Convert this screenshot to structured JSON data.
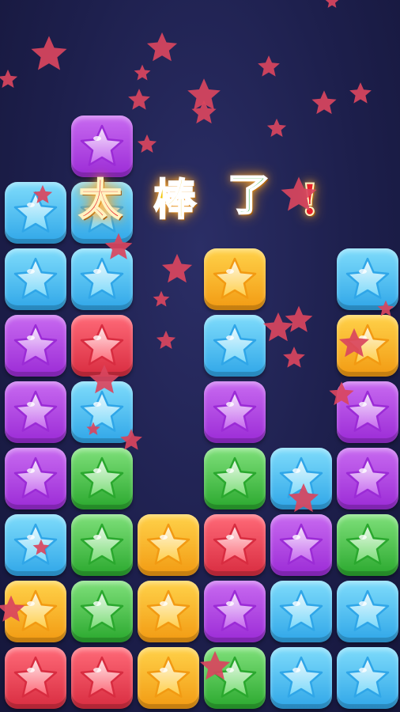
{
  "colors": {
    "purple": [
      "#c86af0",
      "#9b2bd6"
    ],
    "blue": [
      "#7fdcfb",
      "#2fa6e8"
    ],
    "red": [
      "#ff6a78",
      "#d82c40"
    ],
    "green": [
      "#7fe07a",
      "#2aa82e"
    ],
    "yellow": [
      "#ffd24a",
      "#f29a12"
    ],
    "particle": "#d9455e"
  },
  "board": {
    "columns": 6,
    "rows": [
      [
        null,
        "purple",
        null,
        null,
        null,
        null
      ],
      [
        "blue",
        "blue",
        null,
        null,
        null,
        null
      ],
      [
        "blue",
        "blue",
        null,
        "yellow",
        null,
        "blue"
      ],
      [
        "purple",
        "red",
        null,
        "blue",
        null,
        "yellow"
      ],
      [
        "purple",
        "blue",
        null,
        "purple",
        null,
        "purple"
      ],
      [
        "purple",
        "green",
        null,
        "green",
        "blue",
        "purple"
      ],
      [
        "blue",
        "green",
        "yellow",
        "red",
        "purple",
        "green"
      ],
      [
        "yellow",
        "green",
        "yellow",
        "purple",
        "blue",
        "blue"
      ],
      [
        "red",
        "red",
        "yellow",
        "green",
        "blue",
        "blue"
      ]
    ]
  },
  "banner": {
    "chars": [
      "太",
      "棒",
      "了",
      "!"
    ]
  },
  "particles_count": 40
}
